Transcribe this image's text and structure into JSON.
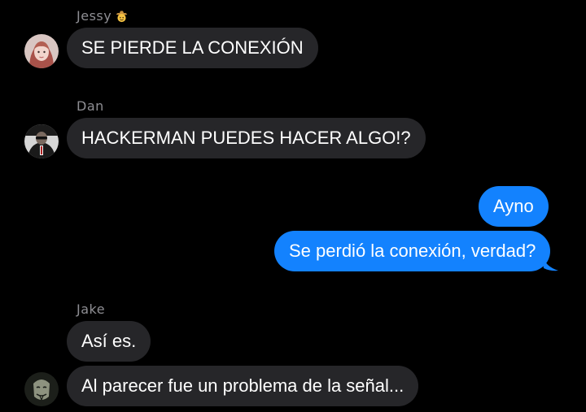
{
  "colors": {
    "background": "#000000",
    "incoming_bubble": "#262629",
    "outgoing_bubble": "#1382fe",
    "sender_name": "#8e8e93",
    "text": "#ffffff"
  },
  "conversation": {
    "groups": [
      {
        "sender": "Jessy",
        "sender_emoji": "cowboy-face-icon",
        "messages": [
          "SE PIERDE LA CONEXIÓN"
        ]
      },
      {
        "sender": "Dan",
        "messages": [
          "HACKERMAN PUEDES HACER ALGO!?"
        ]
      },
      {
        "sender": "me",
        "messages": [
          "Ayno",
          "Se perdió la conexión, verdad?"
        ]
      },
      {
        "sender": "Jake",
        "messages": [
          "Así es.",
          "Al parecer fue un problema de la señal..."
        ]
      }
    ]
  }
}
